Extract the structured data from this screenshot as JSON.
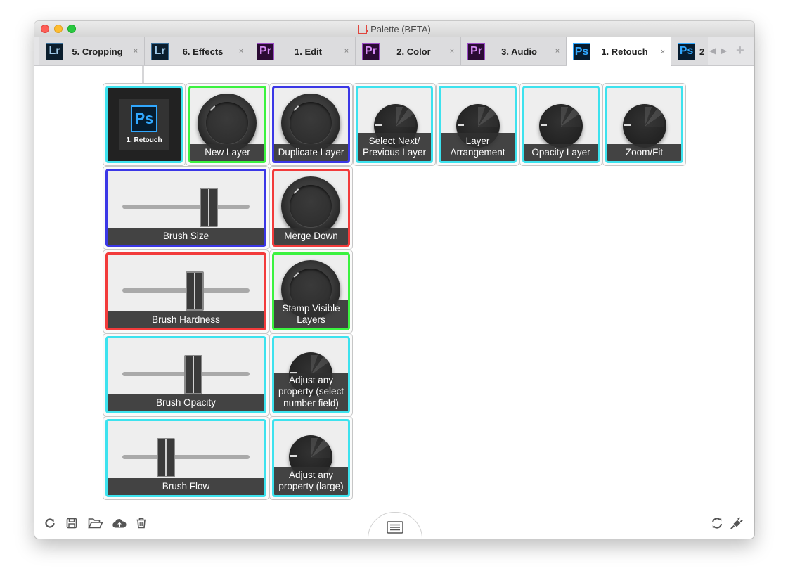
{
  "window": {
    "title": "Palette (BETA)"
  },
  "tabs": [
    {
      "badge": "Lr",
      "label": "5. Cropping"
    },
    {
      "badge": "Lr",
      "label": "6. Effects"
    },
    {
      "badge": "Pr",
      "label": "1. Edit"
    },
    {
      "badge": "Pr",
      "label": "2. Color"
    },
    {
      "badge": "Pr",
      "label": "3. Audio"
    },
    {
      "badge": "Ps",
      "label": "1. Retouch"
    },
    {
      "badge": "Ps",
      "label": "2"
    }
  ],
  "tab_close": "×",
  "tab_add": "+",
  "profile_tile": {
    "badge": "Ps",
    "label": "1. Retouch"
  },
  "controls": {
    "new_layer": "New Layer",
    "duplicate_layer": "Duplicate Layer",
    "select_next_previous_layer": "Select Next/ Previous Layer",
    "layer_arrangement": "Layer Arrangement",
    "opacity_layer": "Opacity Layer",
    "zoom_fit": "Zoom/Fit",
    "brush_size": "Brush Size",
    "merge_down": "Merge Down",
    "brush_hardness": "Brush Hardness",
    "stamp_visible_layers": "Stamp Visible Layers",
    "brush_opacity": "Brush Opacity",
    "adjust_select_number_field": "Adjust any property (select number field)",
    "brush_flow": "Brush Flow",
    "adjust_large": "Adjust any property (large)"
  },
  "slider_levels": {
    "brush_size": 0.68,
    "brush_hardness": 0.57,
    "brush_opacity": 0.56,
    "brush_flow": 0.34
  },
  "colors": {
    "green": "#3bf23f",
    "blue": "#3b37e6",
    "cyan": "#3de2ee",
    "red": "#f23b3b",
    "ps_blue": "#31a8ff"
  },
  "toolbar": {
    "left_icons": [
      "refresh-icon",
      "save-icon",
      "open-folder-icon",
      "cloud-upload-icon",
      "trash-icon"
    ],
    "center_icon": "layout-icon",
    "right_icons": [
      "sync-icon",
      "plug-icon"
    ]
  }
}
